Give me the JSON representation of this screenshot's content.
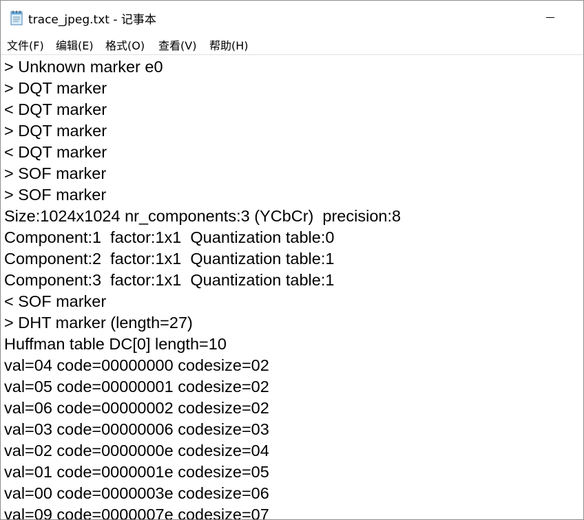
{
  "window": {
    "title": "trace_jpeg.txt - 记事本"
  },
  "titlebar": {
    "icon": "notepad-file-icon",
    "minimize_icon": "minimize-icon"
  },
  "menu": {
    "items": [
      {
        "label": "文件(F)"
      },
      {
        "label": "编辑(E)"
      },
      {
        "label": "格式(O)"
      },
      {
        "label": "查看(V)"
      },
      {
        "label": "帮助(H)"
      }
    ]
  },
  "document": {
    "lines": [
      "> Unknown marker e0",
      "> DQT marker",
      "< DQT marker",
      "> DQT marker",
      "< DQT marker",
      "> SOF marker",
      "> SOF marker",
      "Size:1024x1024 nr_components:3 (YCbCr)  precision:8",
      "Component:1  factor:1x1  Quantization table:0",
      "Component:2  factor:1x1  Quantization table:1",
      "Component:3  factor:1x1  Quantization table:1",
      "< SOF marker",
      "> DHT marker (length=27)",
      "Huffman table DC[0] length=10",
      "val=04 code=00000000 codesize=02",
      "val=05 code=00000001 codesize=02",
      "val=06 code=00000002 codesize=02",
      "val=03 code=00000006 codesize=03",
      "val=02 code=0000000e codesize=04",
      "val=01 code=0000001e codesize=05",
      "val=00 code=0000003e codesize=06",
      "val=09 code=0000007e codesize=07"
    ]
  }
}
